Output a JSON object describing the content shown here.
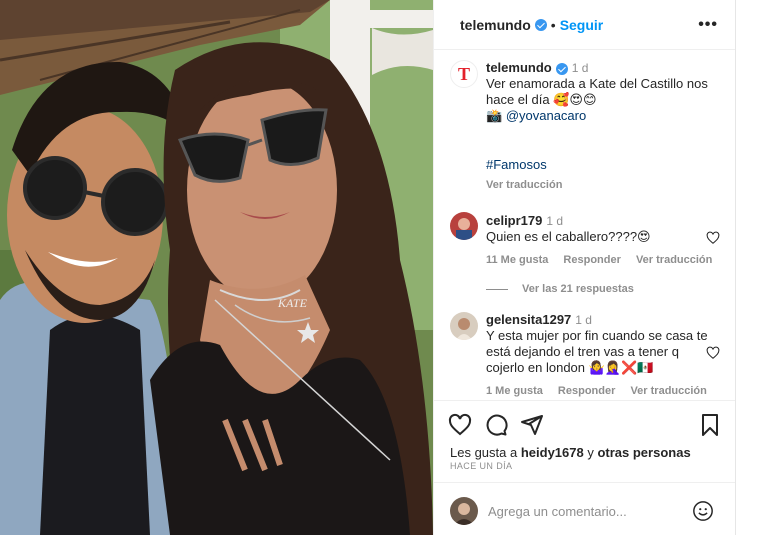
{
  "post": {
    "author": "telemundo",
    "follow_label": "Seguir",
    "more_label": "•••",
    "avatar_letter": "T"
  },
  "caption": {
    "author": "telemundo",
    "time": "1 d",
    "line1": "Ver enamorada a Kate del Castillo nos hace el día 🥰😍😊",
    "line2_prefix": "📸",
    "mention": "@yovanacaro",
    "hashtag": "#Famosos",
    "translate": "Ver traducción"
  },
  "comments": [
    {
      "user": "celipr179",
      "time": "1 d",
      "text": "Quien es el caballero????😍",
      "likes": "11 Me gusta",
      "reply": "Responder",
      "translate": "Ver traducción",
      "replies": "Ver las 21 respuestas"
    },
    {
      "user": "gelensita1297",
      "time": "1 d",
      "text": "Y esta mujer por fin cuando se casa te está dejando el tren vas a tener q cojerlo en london 🤷‍♀️🤦‍♀️❌🇲🇽",
      "likes": "1 Me gusta",
      "reply": "Responder",
      "translate": "Ver traducción"
    }
  ],
  "engagement": {
    "likes_prefix": "Les gusta a",
    "likes_user": "heidy1678",
    "likes_joiner": "y",
    "likes_others": "otras personas",
    "time_ago": "HACE UN DÍA"
  },
  "add_comment": {
    "placeholder": "Agrega un comentario..."
  },
  "colors": {
    "accent": "#0095f6",
    "brand": "#e3202a",
    "verified": "#3897f0",
    "muted": "#8e8e8e"
  },
  "icons": [
    "verified-icon",
    "more-icon",
    "heart-icon",
    "comment-icon",
    "share-icon",
    "bookmark-icon",
    "emoji-icon"
  ]
}
